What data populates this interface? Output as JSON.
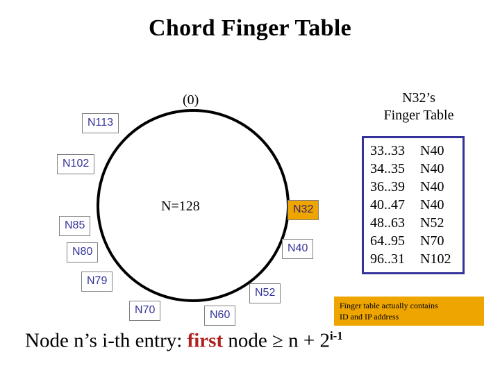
{
  "slide": {
    "title": "Chord Finger Table"
  },
  "ring": {
    "zero_label": "(0)",
    "center_label": "N=128",
    "nodes": [
      {
        "label": "N113",
        "highlight": false
      },
      {
        "label": "N102",
        "highlight": false
      },
      {
        "label": "N85",
        "highlight": false
      },
      {
        "label": "N80",
        "highlight": false
      },
      {
        "label": "N79",
        "highlight": false
      },
      {
        "label": "N70",
        "highlight": false
      },
      {
        "label": "N60",
        "highlight": false
      },
      {
        "label": "N52",
        "highlight": false
      },
      {
        "label": "N40",
        "highlight": false
      },
      {
        "label": "N32",
        "highlight": true
      }
    ],
    "circle_color": "#000000",
    "node_text_color": "#333399",
    "highlight_color": "#EEA500"
  },
  "finger_table": {
    "heading_line1": "N32’s",
    "heading_line2": "Finger Table",
    "border_color": "#333399",
    "rows": [
      {
        "range": "33..33",
        "node": "N40"
      },
      {
        "range": "34..35",
        "node": "N40"
      },
      {
        "range": "36..39",
        "node": "N40"
      },
      {
        "range": "40..47",
        "node": "N40"
      },
      {
        "range": "48..63",
        "node": "N52"
      },
      {
        "range": "64..95",
        "node": "N70"
      },
      {
        "range": "96..31",
        "node": "N102"
      }
    ]
  },
  "note": {
    "line1": "Finger table actually contains",
    "line2": "ID and IP address",
    "background_color": "#EEA500"
  },
  "formula": {
    "prefix": "Node n’s i-th entry: ",
    "emphasis": "first",
    "middle": " node ≥ n + 2",
    "exponent": "i-1",
    "emphasis_color": "#B02020"
  }
}
